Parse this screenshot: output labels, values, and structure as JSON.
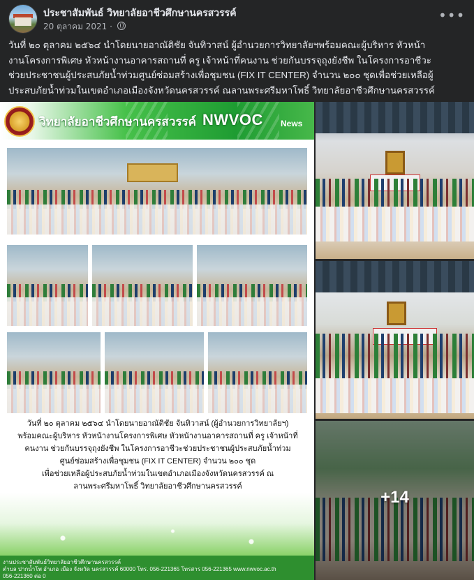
{
  "post": {
    "page_name": "ประชาสัมพันธ์ วิทยาลัยอาชีวศึกษานครสวรรค์",
    "date": "20 ตุลาคม 2021",
    "separator": " · ",
    "privacy_icon": "globe-icon",
    "more_icon": "ellipsis-icon",
    "text_lines": [
      "วันที่ ๒๐ ตุลาคม ๒๕๖๔ นำโดยนายอาณัติชัย จันทิวาสน์ ผู้อำนวยการวิทยาลัยฯพร้อมคณะผู้บริหาร หัวหน้า",
      "งานโครงการพิเศษ หัวหน้างานอาคารสถานที่ ครู เจ้าหน้าที่คนงาน ช่วยกันบรรจุถุงยังชีพ ในโครงการอาชีวะ",
      "ช่วยประชาชนผู้ประสบภัยน้ำท่วมศูนย์ซ่อมสร้างเพื่อชุมชน (FIX IT CENTER) จำนวน ๒๐๐ ชุดเพื่อช่วยเหลือผู้",
      "ประสบภัยน้ำท่วมในเขตอำเภอเมืองจังหวัดนครสวรรค์ ณลานพระศรีมหาโพธิ์ วิทยาลัยอาชีวศึกษานครสวรรค์"
    ]
  },
  "poster": {
    "college_name": "วิทยาลัยอาชีวศึกษานครสวรรค์",
    "brand": "NWVOC",
    "brand_sub": "News",
    "caption_lines": [
      "วันที่ ๒๐ ตุลาคม ๒๕๖๔ นำโดยนายอาณัติชัย จันทิวาสน์ (ผู้อำนวยการวิทยาลัยฯ)",
      "พร้อมคณะผู้บริหาร หัวหน้างานโครงการพิเศษ หัวหน้างานอาคารสถานที่ ครู เจ้าหน้าที่",
      "คนงาน ช่วยกันบรรจุถุงยังชีพ ในโครงการอาชีวะช่วยประชาชนผู้ประสบภัยน้ำท่วม",
      "ศูนย์ซ่อมสร้างเพื่อชุมชน (FIX IT CENTER) จำนวน ๒๐๐ ชุด",
      "เพื่อช่วยเหลือผู้ประสบภัยน้ำท่วมในเขตอำเภอเมืองจังหวัดนครสวรรค์ ณ",
      "ลานพระศรีมหาโพธิ์ วิทยาลัยอาชีวศึกษานครสวรรค์"
    ],
    "footer_line1": "งานประชาสัมพันธ์วิทยาลัยอาชีวศึกษานครสวรรค์",
    "footer_line2": "ตำบล ปากน้ำโพ อำเภอ เมือง จังหวัด นครสวรรค์ 60000 โทร. 056-221365 โทรสาร 056-221365 www.nwvoc.ac.th",
    "footer_line3": "056-221360 ต่อ 0"
  },
  "photos": {
    "more_count": "+14"
  }
}
